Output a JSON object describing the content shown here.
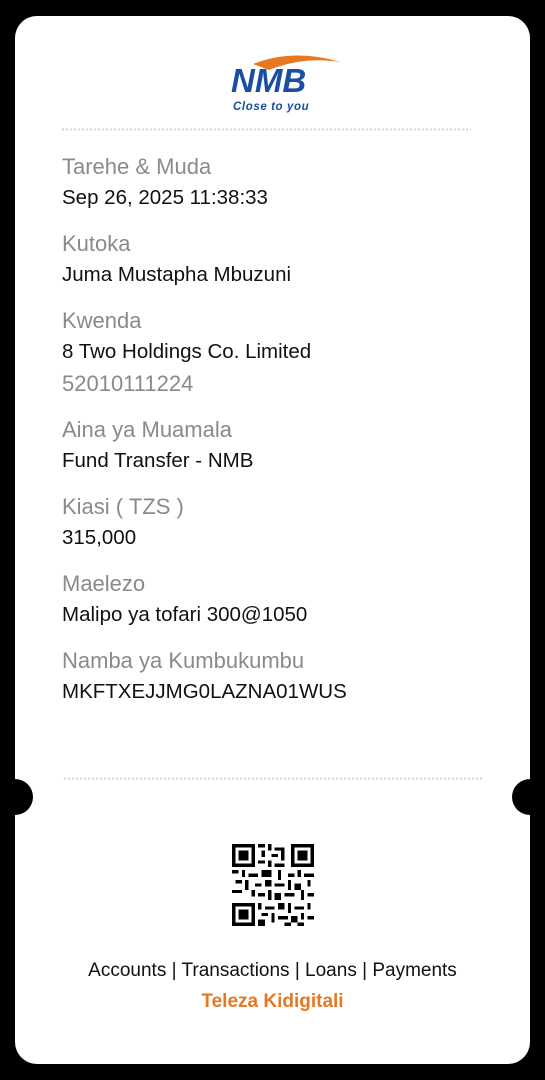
{
  "brand": {
    "name": "NMB",
    "tagline": "Close to you",
    "primary_color": "#1a4ea2",
    "accent_color": "#e87722"
  },
  "receipt": {
    "fields": [
      {
        "label": "Tarehe & Muda",
        "value": "Sep 26, 2025 11:38:33"
      },
      {
        "label": "Kutoka",
        "value": "Juma Mustapha Mbuzuni"
      },
      {
        "label": "Kwenda",
        "value": "8 Two Holdings Co. Limited",
        "subvalue": "52010111224"
      },
      {
        "label": "Aina ya Muamala",
        "value": "Fund Transfer - NMB"
      },
      {
        "label": "Kiasi ( TZS )",
        "value": "315,000"
      },
      {
        "label": "Maelezo",
        "value": "Malipo ya tofari 300@1050"
      },
      {
        "label": "Namba ya Kumbukumbu",
        "value": "MKFTXEJJMG0LAZNA01WUS"
      }
    ]
  },
  "footer": {
    "qr_icon": "qr-code-icon",
    "links": [
      "Accounts",
      "Transactions",
      "Loans",
      "Payments"
    ],
    "separator": "|",
    "tagline": "Teleza Kidigitali"
  }
}
